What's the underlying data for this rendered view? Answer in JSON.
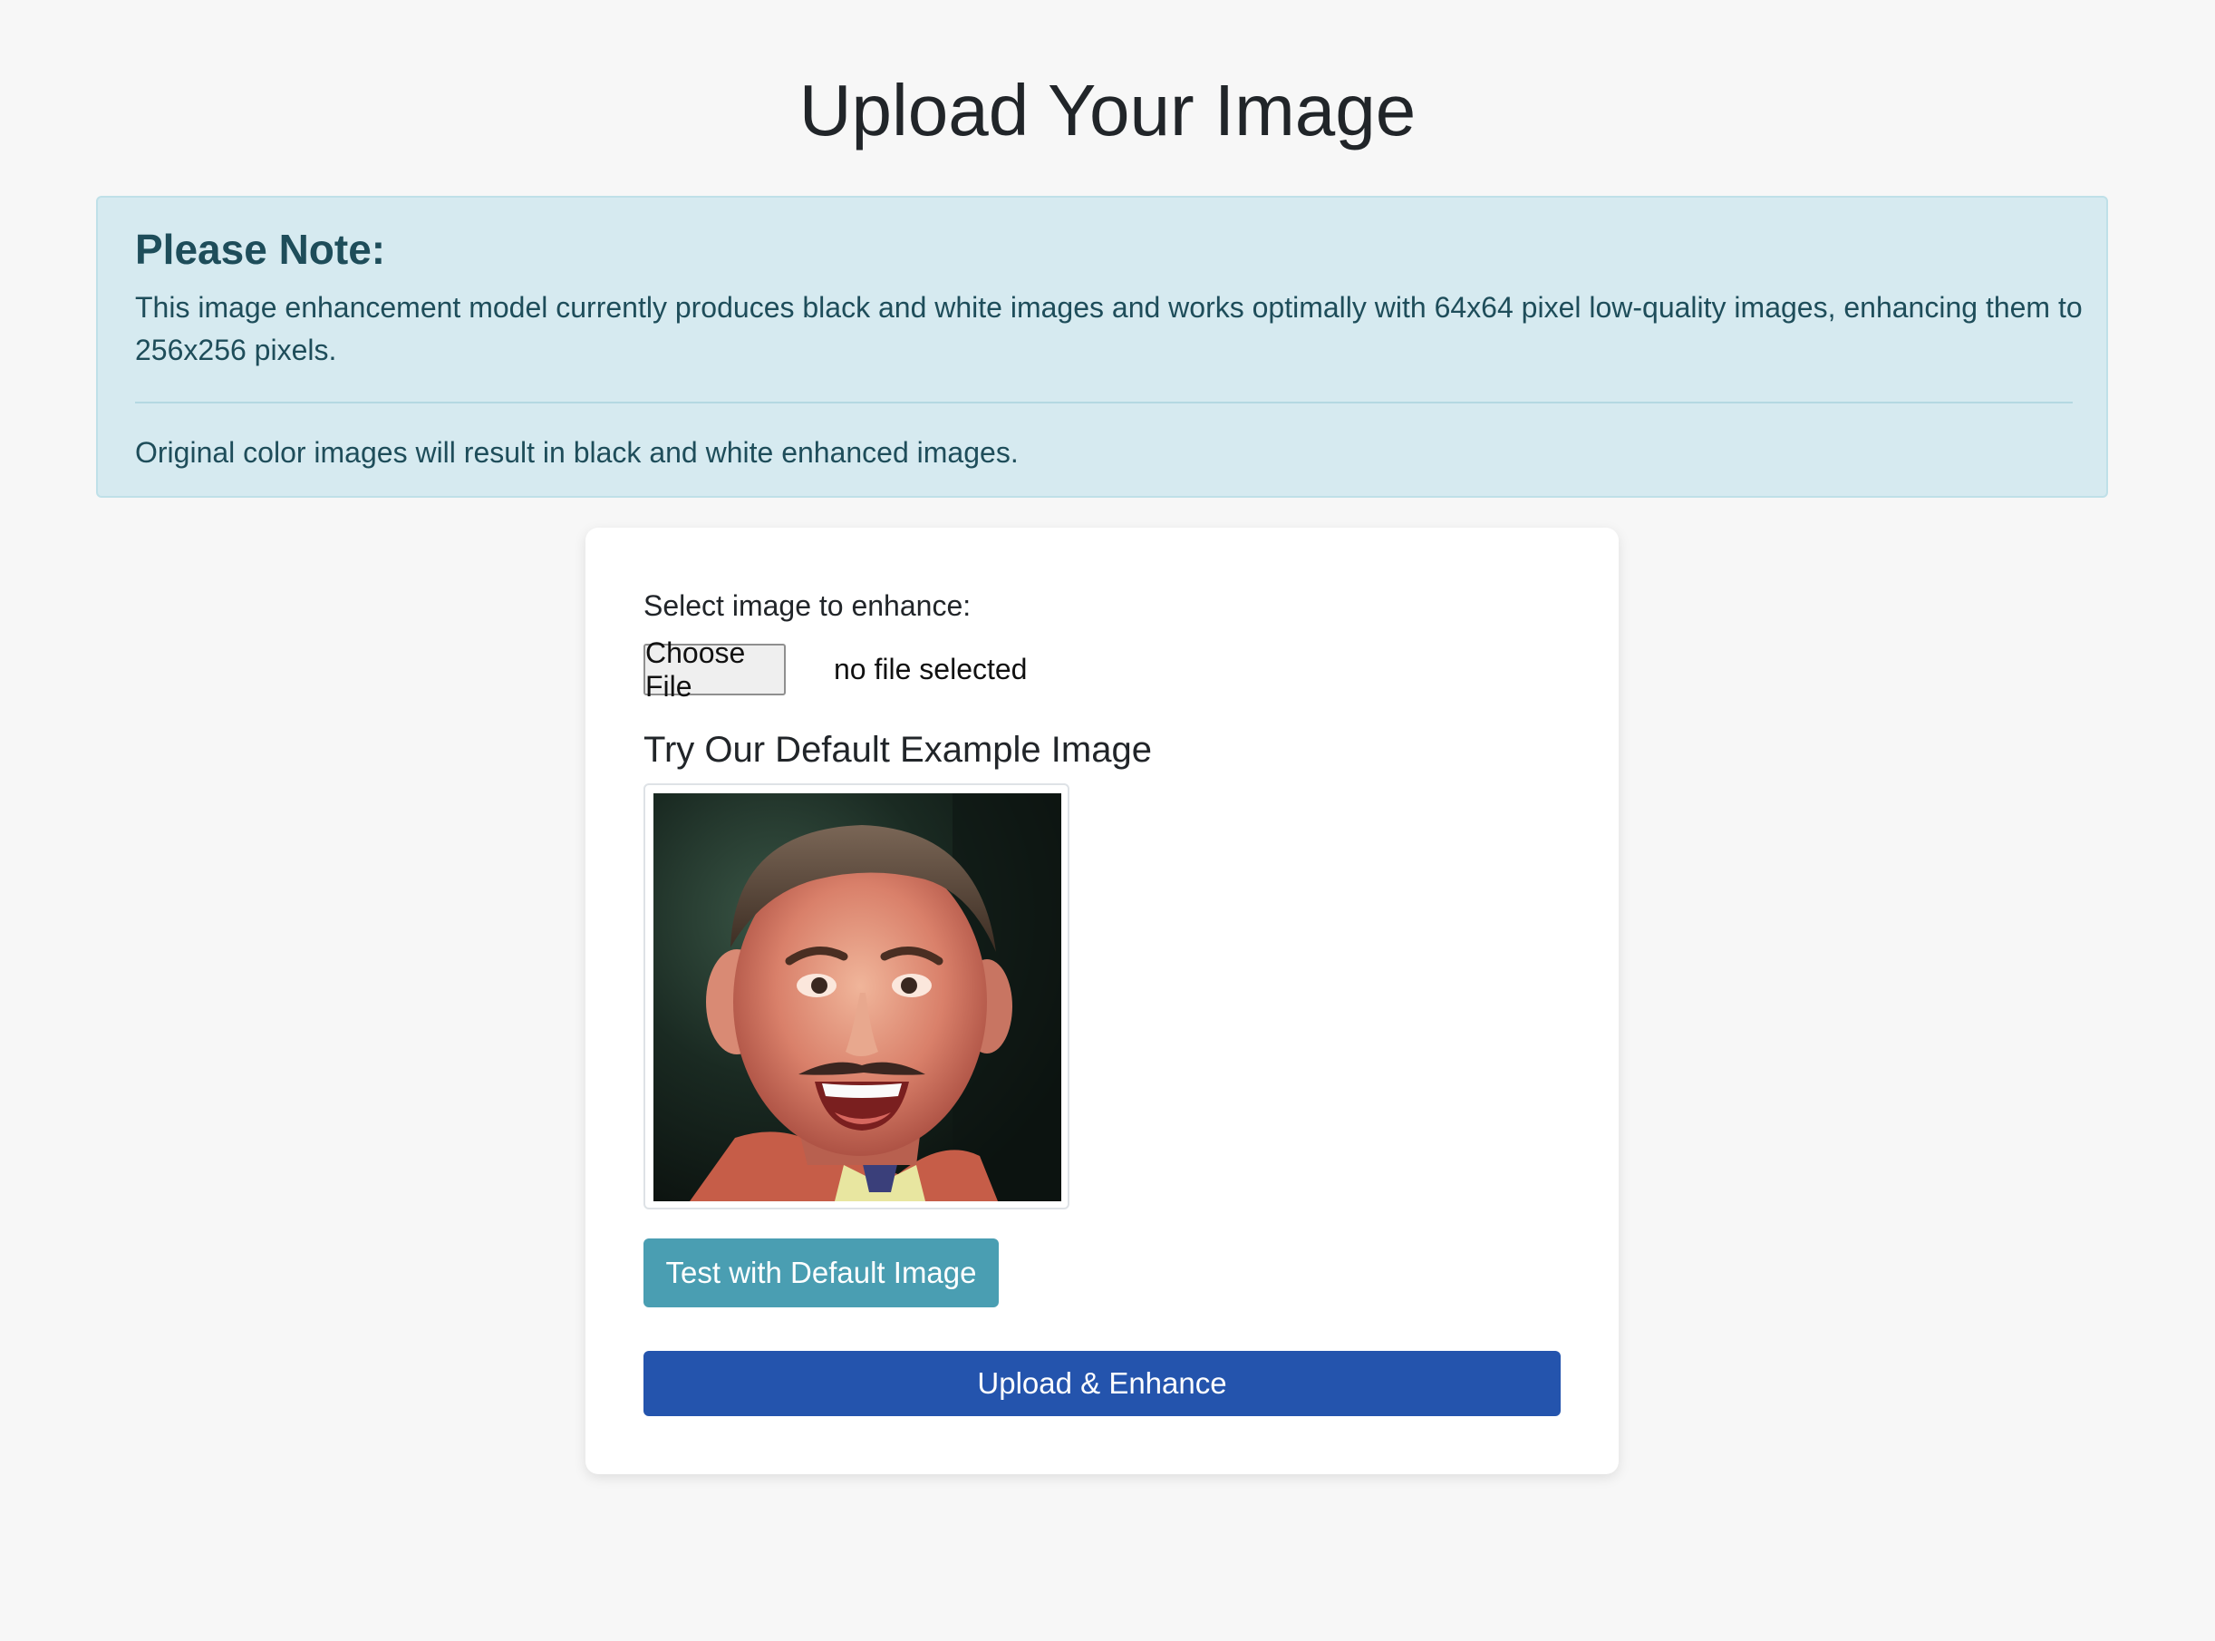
{
  "header": {
    "title": "Upload Your Image"
  },
  "note": {
    "heading": "Please Note:",
    "line1": "This image enhancement model currently produces black and white images and works optimally with 64x64 pixel low-quality images, enhancing them to 256x256 pixels.",
    "line2": "Original color images will result in black and white enhanced images."
  },
  "form": {
    "select_label": "Select image to enhance:",
    "file_button_label": "Choose File",
    "file_status": "no file selected",
    "example_heading": "Try Our Default Example Image",
    "example_image_icon": "portrait-photo",
    "test_button_label": "Test with Default Image",
    "submit_button_label": "Upload & Enhance"
  },
  "colors": {
    "note_background": "#d6eaf0",
    "note_text": "#1e4d5a",
    "test_button": "#4a9eb2",
    "submit_button": "#2454ad"
  }
}
